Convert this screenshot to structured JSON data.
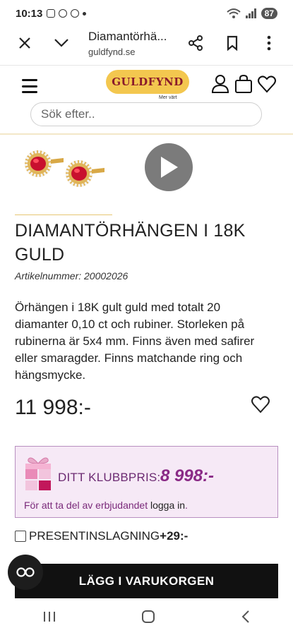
{
  "status_bar": {
    "time": "10:13",
    "battery": "87"
  },
  "browser": {
    "page_title": "Diamantörhä...",
    "domain": "guldfynd.se"
  },
  "header": {
    "logo_text": "GULDFYND",
    "logo_sub": "Mer värt",
    "search_placeholder": "Sök efter.."
  },
  "product": {
    "title": "DIAMANTÖRHÄNGEN I 18K GULD",
    "article_number": "Artikelnummer: 20002026",
    "description": "Örhängen i 18K gult guld med totalt 20 diamanter 0,10 ct och rubiner. Storleken på rubinerna är 5x4 mm. Finns även med safirer eller smaragder. Finns matchande ring och hängsmycke.",
    "price": "11 998:-"
  },
  "club": {
    "label": "DITT KLUBBPRIS:",
    "price": "8 998:-",
    "note_prefix": "För att ta del av erbjudandet ",
    "note_link": "logga in",
    "note_suffix": "."
  },
  "gift_wrap": {
    "label": "PRESENTINSLAGNING",
    "price": "+29:-"
  },
  "cart": {
    "button_label": "LÄGG I VARUKORGEN"
  },
  "colors": {
    "accent_gold": "#f3c74f",
    "club_purple": "#8a2a86",
    "club_bg": "#f6e9f6"
  },
  "icons": [
    "close-icon",
    "chevron-down-icon",
    "share-icon",
    "bookmark-icon",
    "more-icon",
    "hamburger-icon",
    "user-icon",
    "cart-icon",
    "heart-icon",
    "play-icon",
    "gift-icon",
    "glasses-icon"
  ]
}
